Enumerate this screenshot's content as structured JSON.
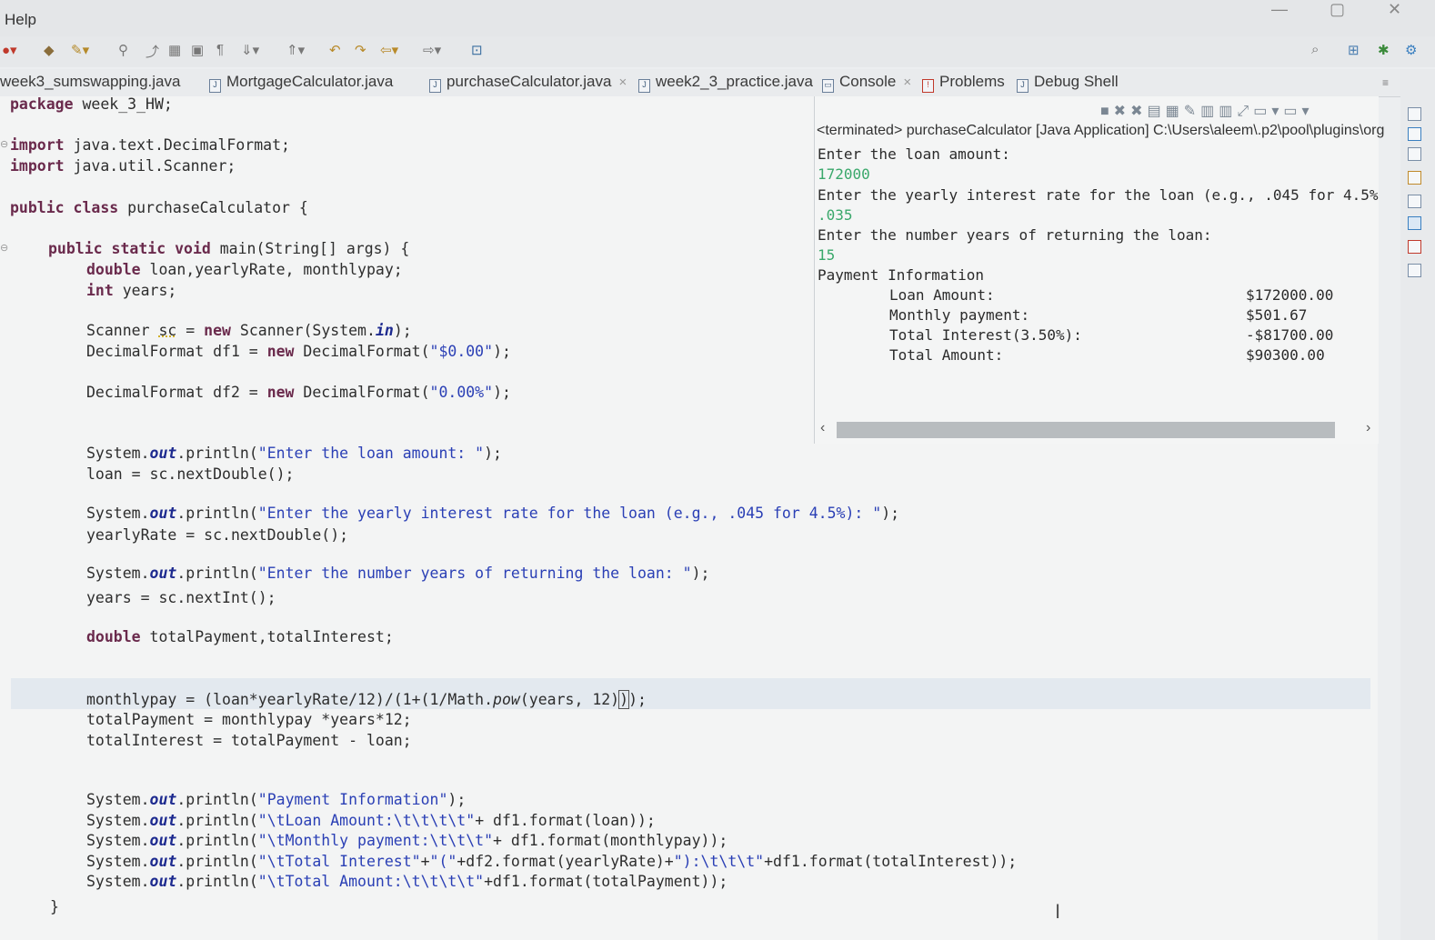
{
  "menu": {
    "help": "Help"
  },
  "editor_tabs": [
    {
      "label": "week3_sumswapping.java",
      "active": false
    },
    {
      "label": "MortgageCalculator.java",
      "active": false
    },
    {
      "label": "purchaseCalculator.java",
      "active": true,
      "close": "×"
    },
    {
      "label": "week2_3_practice.java",
      "active": false
    }
  ],
  "view_tabs": [
    {
      "label": "Console",
      "active": true,
      "close": "×"
    },
    {
      "label": "Problems",
      "active": false
    },
    {
      "label": "Debug Shell",
      "active": false
    }
  ],
  "code_lines": {
    "pkg_kw": "package",
    "pkg_name": " week_3_HW;",
    "imp1_kw": "import",
    "imp1_rest": " java.text.DecimalFormat;",
    "imp2_kw": "import",
    "imp2_rest": " java.util.Scanner;",
    "cls_kw": "public class",
    "cls_rest": " purchaseCalculator {",
    "main_kw": "public static void",
    "main_rest": " main(String[] args) {",
    "l1_kw": "double",
    "l1_rest": " loan,yearlyRate, monthlypay;",
    "l2_kw": "int",
    "l2_rest": " years;",
    "l3_a": "Scanner ",
    "l3_b": "sc",
    "l3_c": " = ",
    "l3_kw": "new",
    "l3_d": " Scanner(System.",
    "l3_fld": "in",
    "l3_e": ");",
    "l4_a": "DecimalFormat df1 = ",
    "l4_kw": "new",
    "l4_b": " DecimalFormat(",
    "l4_str": "\"$0.00\"",
    "l4_c": ");",
    "l5_a": "DecimalFormat df2 = ",
    "l5_kw": "new",
    "l5_b": " DecimalFormat(",
    "l5_str": "\"0.00%\"",
    "l5_c": ");",
    "p1_a": "System.",
    "p1_fld": "out",
    "p1_b": ".println(",
    "p1_str": "\"Enter the loan amount: \"",
    "p1_c": ");",
    "r1": "loan = sc.nextDouble();",
    "p2_a": "System.",
    "p2_fld": "out",
    "p2_b": ".println(",
    "p2_str": "\"Enter the yearly interest rate for the loan (e.g., .045 for 4.5%): \"",
    "p2_c": ");",
    "r2": "yearlyRate = sc.nextDouble();",
    "p3_a": "System.",
    "p3_fld": "out",
    "p3_b": ".println(",
    "p3_str": "\"Enter the number years of returning the loan: \"",
    "p3_c": ");",
    "r3": "years = sc.nextInt();",
    "d1_kw": "double",
    "d1_rest": " totalPayment,totalInterest;",
    "c1_a": "monthlypay = (loan*yearlyRate/12)/(1+(1/Math.",
    "c1_m": "pow",
    "c1_b": "(years, 12)",
    "c1_cursor": ")",
    "c1_c": ");",
    "c2": "totalPayment = monthlypay *years*12;",
    "c3": "totalInterest = totalPayment - loan;",
    "o1_a": "System.",
    "o1_fld": "out",
    "o1_b": ".println(",
    "o1_str": "\"Payment Information\"",
    "o1_c": ");",
    "o2_a": "System.",
    "o2_fld": "out",
    "o2_b": ".println(",
    "o2_str": "\"\\tLoan Amount:\\t\\t\\t\\t\"",
    "o2_c": "+ df1.format(loan));",
    "o3_a": "System.",
    "o3_fld": "out",
    "o3_b": ".println(",
    "o3_str": "\"\\tMonthly payment:\\t\\t\\t\"",
    "o3_c": "+ df1.format(monthlypay));",
    "o4_a": "System.",
    "o4_fld": "out",
    "o4_b": ".println(",
    "o4_str1": "\"\\tTotal Interest\"",
    "o4_p1": "+",
    "o4_str2": "\"(\"",
    "o4_p2": "+df2.format(yearlyRate)+",
    "o4_str3": "\"):\\t\\t\\t\"",
    "o4_c": "+df1.format(totalInterest));",
    "o5_a": "System.",
    "o5_fld": "out",
    "o5_b": ".println(",
    "o5_str": "\"\\tTotal Amount:\\t\\t\\t\\t\"",
    "o5_c": "+df1.format(totalPayment));",
    "close_brace": "}"
  },
  "console": {
    "header": "<terminated> purchaseCalculator [Java Application] C:\\Users\\aleem\\.p2\\pool\\plugins\\org",
    "prompt1": "Enter the loan amount:",
    "input1": "172000",
    "prompt2": "Enter the yearly interest rate for the loan (e.g., .045 for 4.5%",
    "input2": ".035",
    "prompt3": "Enter the number years of returning the loan:",
    "input3": "15",
    "info_title": "Payment Information",
    "rows": [
      {
        "label": "Loan Amount:",
        "value": "$172000.00"
      },
      {
        "label": "Monthly payment:",
        "value": "$501.67"
      },
      {
        "label": "Total Interest(3.50%):",
        "value": "-$81700.00"
      },
      {
        "label": "Total Amount:",
        "value": "$90300.00"
      }
    ]
  },
  "icons": {
    "console_toolbar": [
      "stop-icon",
      "remove-launch-icon",
      "remove-all-icon",
      "scroll-lock-icon",
      "word-wrap-icon",
      "show-console-icon",
      "pin-icon",
      "new-console-icon"
    ],
    "scroll_left": "‹",
    "scroll_right": "›"
  }
}
